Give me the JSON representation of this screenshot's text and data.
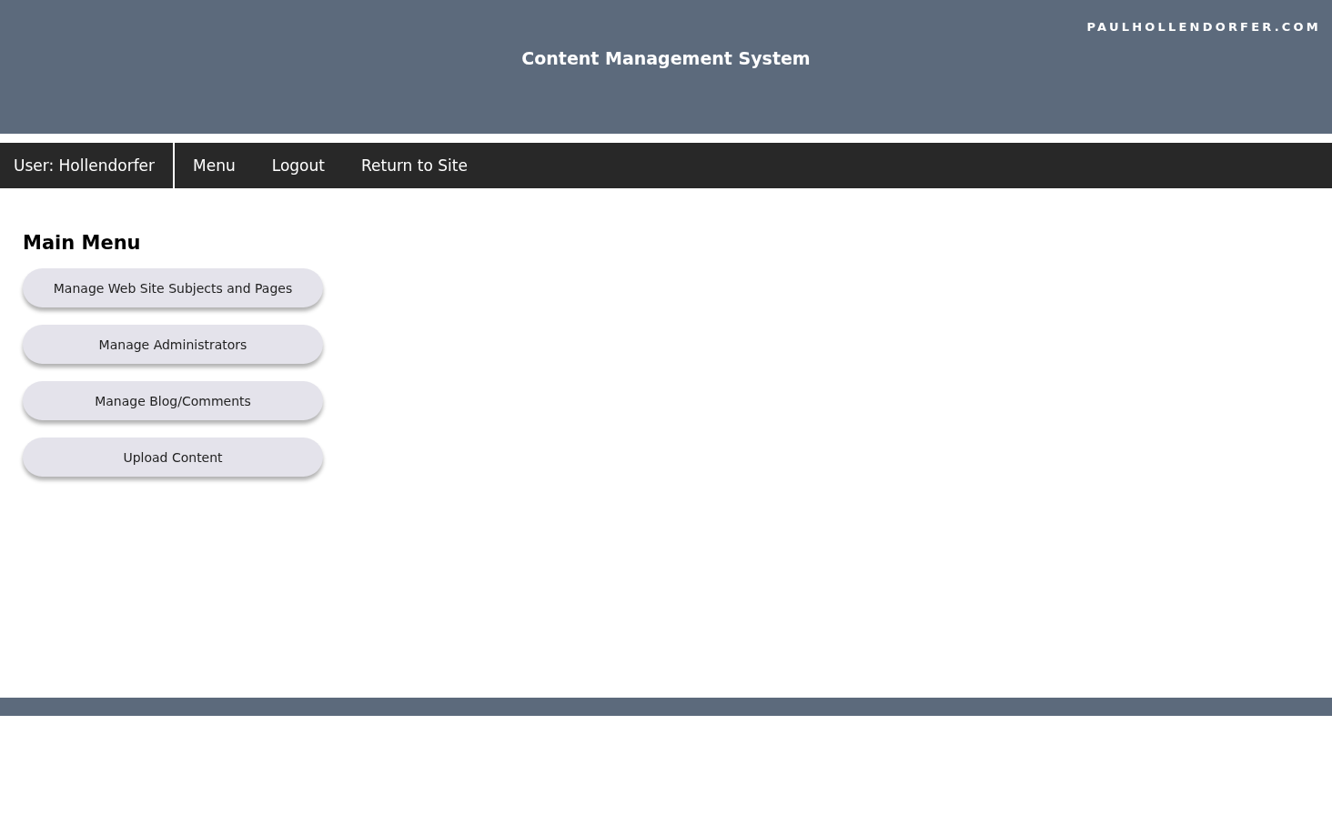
{
  "header": {
    "site_name": "PAULHOLLENDORFER.COM",
    "title": "Content Management System"
  },
  "nav": {
    "user": "User: Hollendorfer",
    "links": [
      "Menu",
      "Logout",
      "Return to Site"
    ]
  },
  "main_menu": {
    "heading": "Main Menu",
    "buttons": [
      "Manage Web Site Subjects and Pages",
      "Manage Administrators",
      "Manage Blog/Comments",
      "Upload Content"
    ]
  }
}
